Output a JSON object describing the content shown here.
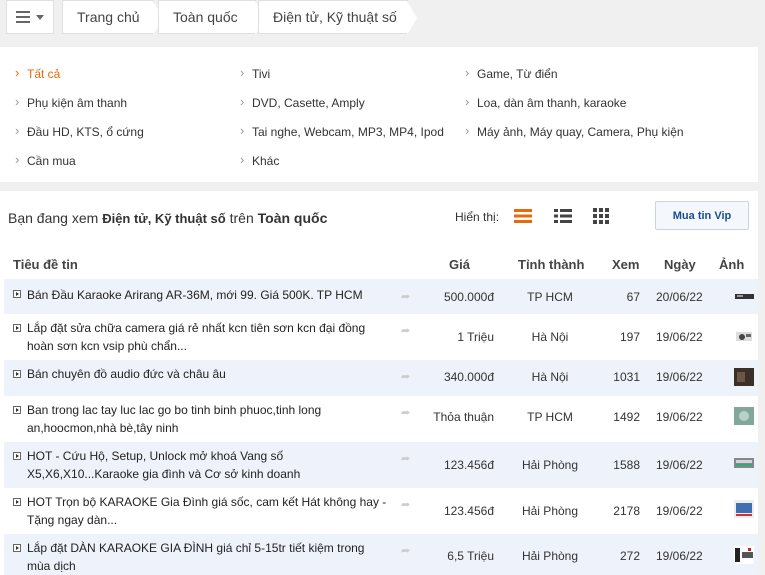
{
  "breadcrumb": {
    "items": [
      "Trang chủ",
      "Toàn quốc",
      "Điện tử, Kỹ thuật số"
    ]
  },
  "categories": [
    {
      "label": "Tất cả",
      "active": true
    },
    {
      "label": "Tivi",
      "active": false
    },
    {
      "label": "Game, Từ điển",
      "active": false
    },
    {
      "label": "Phụ kiện âm thanh",
      "active": false
    },
    {
      "label": "DVD, Casette, Amply",
      "active": false
    },
    {
      "label": "Loa, dàn âm thanh, karaoke",
      "active": false
    },
    {
      "label": "Đầu HD, KTS, ổ cứng",
      "active": false
    },
    {
      "label": "Tai nghe, Webcam, MP3, MP4, Ipod",
      "active": false
    },
    {
      "label": "Máy ảnh, Máy quay, Camera, Phụ kiện",
      "active": false
    },
    {
      "label": "Cần mua",
      "active": false
    },
    {
      "label": "Khác",
      "active": false
    }
  ],
  "info": {
    "prefix": "Bạn đang xem",
    "category": "Điện tử, Kỹ thuật số",
    "middle": "trên",
    "location": "Toàn quốc"
  },
  "view": {
    "label": "Hiển thị:",
    "active_mode": "list-rows",
    "accent_color": "#e8690a"
  },
  "mua_vip_label": "Mua tin Vip",
  "table": {
    "headers": {
      "title": "Tiêu đề tin",
      "price": "Giá",
      "province": "Tỉnh thành",
      "views": "Xem",
      "date": "Ngày",
      "image": "Ảnh"
    },
    "rows": [
      {
        "title": "Bán Đầu Karaoke Arirang AR-36M, mới 99. Giá 500K. TP HCM",
        "price": "500.000đ",
        "province": "TP HCM",
        "views": "67",
        "date": "20/06/22"
      },
      {
        "title": "Lắp đặt sửa chữa camera giá rẻ nhất kcn tiên sơn kcn đại đồng hoàn sơn kcn vsip phù chẩn...",
        "price": "1 Triệu",
        "province": "Hà Nội",
        "views": "197",
        "date": "19/06/22"
      },
      {
        "title": "Bán chuyên đồ audio đức và châu âu",
        "price": "340.000đ",
        "province": "Hà Nội",
        "views": "1031",
        "date": "19/06/22"
      },
      {
        "title": "Ban trong lac tay luc lac go bo tinh binh phuoc,tinh long an,hoocmon,nhà bè,tây ninh",
        "price": "Thỏa thuận",
        "province": "TP HCM",
        "views": "1492",
        "date": "19/06/22"
      },
      {
        "title": "HOT - Cứu Hộ, Setup, Unlock mở khoá Vang số X5,X6,X10...Karaoke gia đình và Cơ sở kinh doanh",
        "price": "123.456đ",
        "province": "Hải Phòng",
        "views": "1588",
        "date": "19/06/22"
      },
      {
        "title": "HOT Trọn bộ KARAOKE Gia Đình giá sốc, cam kết Hát không hay - Tặng ngay dàn...",
        "price": "123.456đ",
        "province": "Hải Phòng",
        "views": "2178",
        "date": "19/06/22"
      },
      {
        "title": "Lắp đặt DÀN KARAOKE GIA ĐÌNH giá chỉ 5-15tr tiết kiệm trong mùa dịch",
        "price": "6,5 Triệu",
        "province": "Hải Phòng",
        "views": "272",
        "date": "19/06/22"
      }
    ]
  }
}
